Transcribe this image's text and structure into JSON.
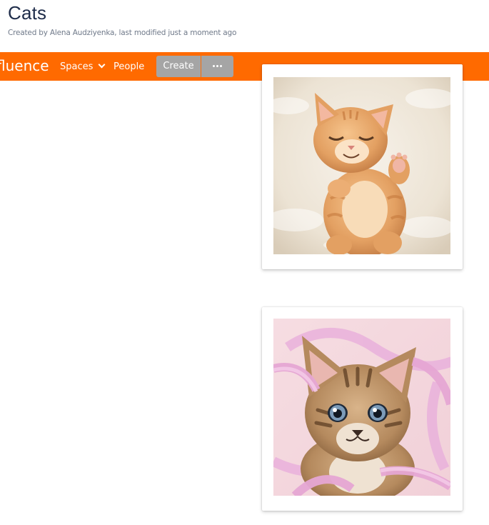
{
  "page": {
    "title": "Cats",
    "byline": "Created by Alena Audziyenka, last modified just a moment ago"
  },
  "nav": {
    "brand": "fluence",
    "spaces_label": "Spaces",
    "people_label": "People",
    "create_label": "Create",
    "more_icon": "ellipsis-icon",
    "background_color": "#ff6a00",
    "button_color": "#a5a5a5"
  },
  "images": [
    {
      "description": "sleeping-orange-kitten"
    },
    {
      "description": "tabby-kitten-pink-ribbons"
    }
  ]
}
